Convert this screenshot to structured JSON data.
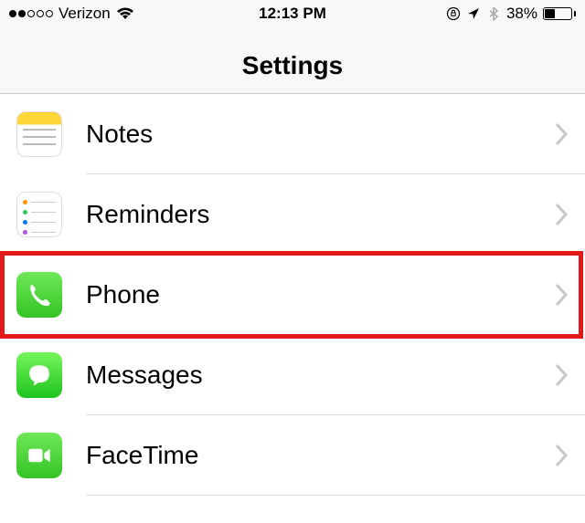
{
  "status_bar": {
    "carrier": "Verizon",
    "signal_filled": 2,
    "signal_total": 5,
    "time": "12:13 PM",
    "battery_percent": "38%",
    "battery_level": 38
  },
  "header": {
    "title": "Settings"
  },
  "rows": [
    {
      "id": "notes",
      "label": "Notes",
      "highlighted": false
    },
    {
      "id": "reminders",
      "label": "Reminders",
      "highlighted": false
    },
    {
      "id": "phone",
      "label": "Phone",
      "highlighted": true
    },
    {
      "id": "messages",
      "label": "Messages",
      "highlighted": false
    },
    {
      "id": "facetime",
      "label": "FaceTime",
      "highlighted": false
    }
  ]
}
